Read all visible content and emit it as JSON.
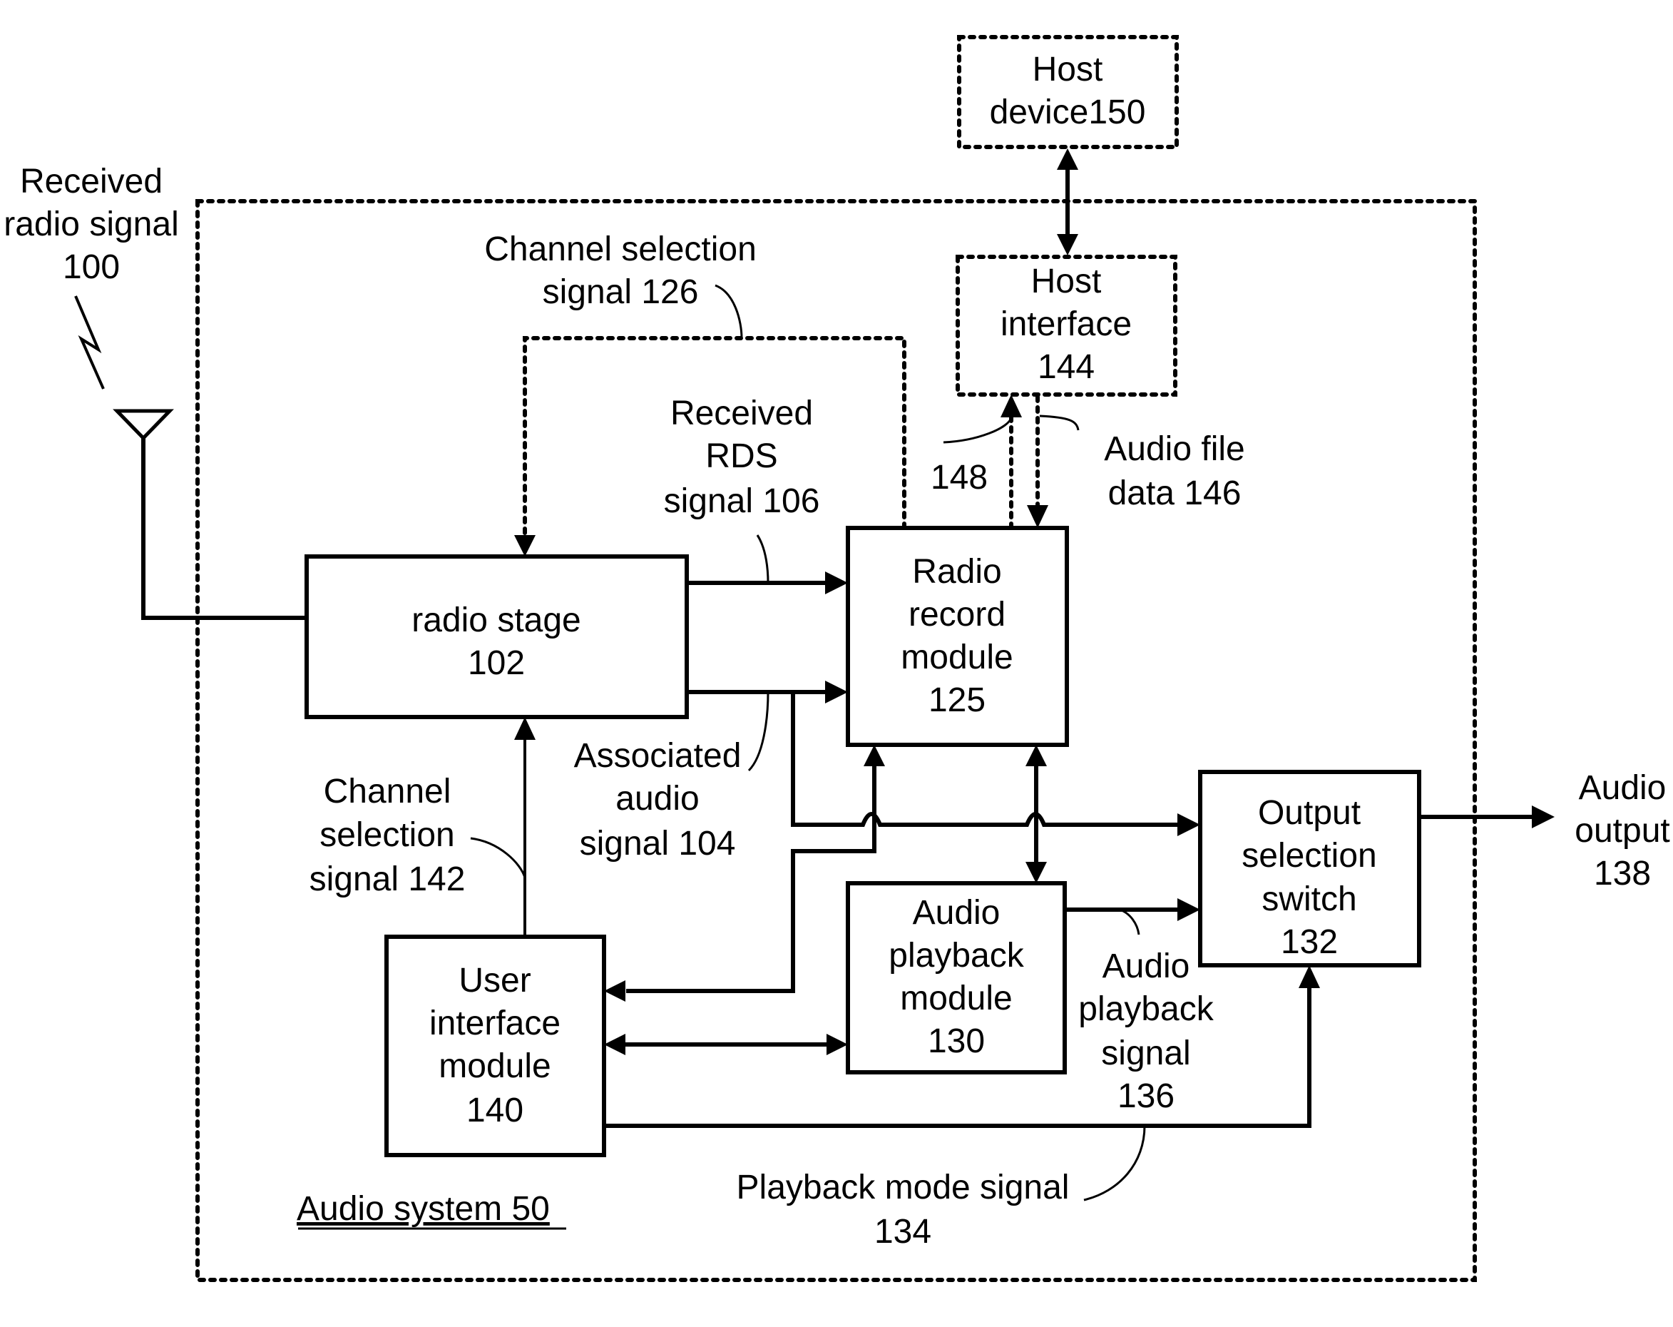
{
  "diagram": {
    "system_label": "Audio system 50",
    "blocks": {
      "host_device": [
        "Host",
        "device150"
      ],
      "host_interface": [
        "Host",
        "interface",
        "144"
      ],
      "radio_stage": [
        "radio stage",
        "102"
      ],
      "radio_record": [
        "Radio",
        "record",
        "module",
        "125"
      ],
      "output_switch": [
        "Output",
        "selection",
        "switch",
        "132"
      ],
      "audio_playback": [
        "Audio",
        "playback",
        "module",
        "130"
      ],
      "user_interface": [
        "User",
        "interface",
        "module",
        "140"
      ]
    },
    "labels": {
      "received_radio": [
        "Received",
        "radio signal",
        "100"
      ],
      "channel_sel_126": [
        "Channel selection",
        "signal 126"
      ],
      "rds_106": [
        "Received",
        "RDS",
        "signal 106"
      ],
      "sig_148": [
        "148"
      ],
      "audio_file_146": [
        "Audio file",
        "data 146"
      ],
      "assoc_audio_104": [
        "Associated",
        "audio",
        "signal 104"
      ],
      "channel_sel_142": [
        "Channel",
        "selection",
        "signal 142"
      ],
      "audio_output_138": [
        "Audio",
        "output",
        "138"
      ],
      "playback_sig_136": [
        "Audio",
        "playback",
        "signal",
        "136"
      ],
      "playback_mode_134": [
        "Playback mode signal",
        "134"
      ]
    }
  }
}
